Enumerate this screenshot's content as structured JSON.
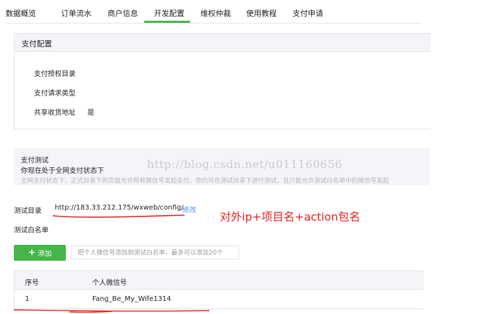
{
  "nav": {
    "tabs": [
      "数据概览",
      "订单流水",
      "商户信息",
      "开发配置",
      "维权仲裁",
      "使用教程",
      "支付申请"
    ],
    "active_index": 3,
    "accent": "#44b549"
  },
  "config": {
    "title": "支付配置",
    "rows": [
      {
        "label": "支付授权目录",
        "value": ""
      },
      {
        "label": "支付请求类型",
        "value": ""
      },
      {
        "label": "共享收货地址",
        "value": "是"
      }
    ]
  },
  "test": {
    "title": "支付测试",
    "status": "你现在处于全网支付状态下",
    "description": "全网支付状态下，正式目录下的页面允许所有微信号发起支付。你仍可在测试目录下进行测试，且只能允许测试白名单中的微信号发起"
  },
  "test_dir": {
    "label": "测试目录",
    "value": "http://183.33.212.175/wxweb/config/",
    "edit_label": "修改"
  },
  "whitelist": {
    "label": "测试白名单",
    "add_button": "添加",
    "hint": "把个人微信号添加到测试白名单，最多可以添加20个",
    "columns": [
      "序号",
      "个人微信号"
    ],
    "rows": [
      {
        "index": "1",
        "wechat_id": "Fang_Be_My_Wife1314"
      }
    ]
  },
  "watermark": "http://blog.csdn.net/u011160656",
  "annotation": {
    "text": "对外ip+项目名+action包名",
    "color": "#e8201f"
  }
}
